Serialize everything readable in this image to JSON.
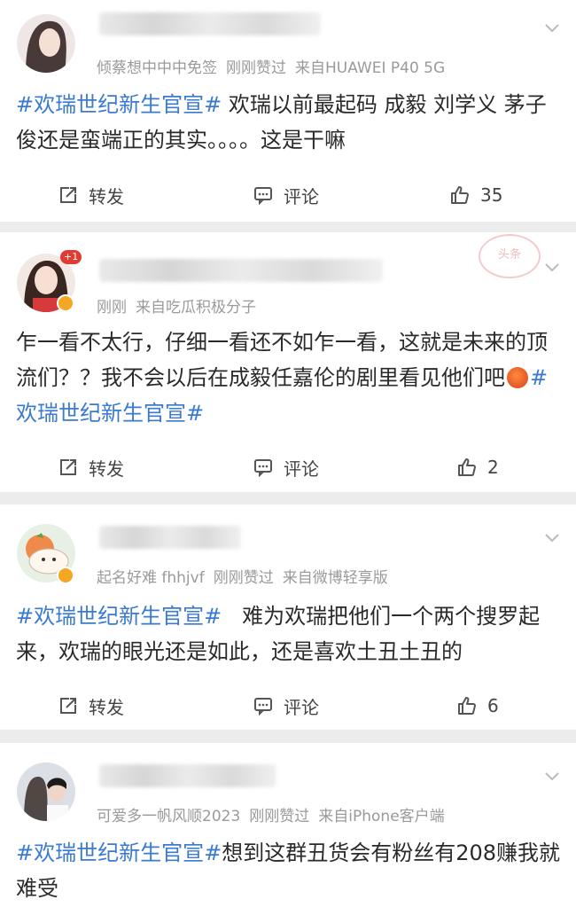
{
  "posts": [
    {
      "meta": [
        "倾蔡想中中中免签",
        "刚刚赞过",
        "来自HUAWEI P40 5G"
      ],
      "topic": "#欢瑞世纪新生官宣#",
      "body": "欢瑞以前最起码 成毅 刘学义 茅子俊还是蛮端正的其实。。。。这是干嘛",
      "repost_label": "转发",
      "comment_label": "评论",
      "like_count": "35"
    },
    {
      "plus_badge": "+1",
      "stamp": "头条",
      "meta": [
        "刚刚",
        "来自吃瓜积极分子"
      ],
      "body": "乍一看不太行，仔细一看还不如乍一看，这就是未来的顶流们？？我不会以后在成毅任嘉伦的剧里看见他们吧",
      "topic": "#欢瑞世纪新生官宣#",
      "repost_label": "转发",
      "comment_label": "评论",
      "like_count": "2"
    },
    {
      "meta": [
        "起名好难 fhhjvf",
        "刚刚赞过",
        "来自微博轻享版"
      ],
      "topic": "#欢瑞世纪新生官宣#",
      "body": "难为欢瑞把他们一个两个搜罗起来，欢瑞的眼光还是如此，还是喜欢土丑土丑的",
      "repost_label": "转发",
      "comment_label": "评论",
      "like_count": "6"
    },
    {
      "meta": [
        "可爱多一帆风顺2023",
        "刚刚赞过",
        "来自iPhone客户端"
      ],
      "topic": "#欢瑞世纪新生官宣#",
      "body": "想到这群丑货会有粉丝有208赚我就难受"
    }
  ],
  "colors": {
    "topic": "#3a7ad1",
    "meta": "#9a9a9a",
    "background": "#ececec",
    "verified": "#f5a623"
  },
  "icons": [
    "share-icon",
    "comment-icon",
    "like-icon",
    "chevron-down-icon",
    "angry-emoji-icon"
  ]
}
